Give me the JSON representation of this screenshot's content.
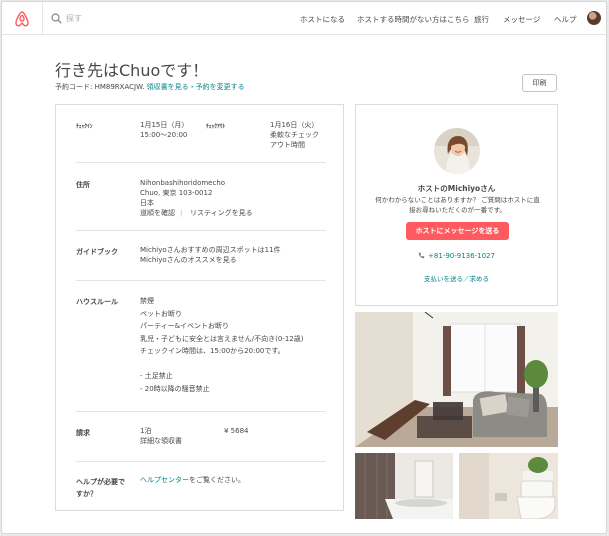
{
  "nav": {
    "search_placeholder": "探す",
    "links": [
      "ホストになる",
      "ホストする時間がない方はこちら",
      "旅行",
      "メッセージ",
      "ヘルプ"
    ]
  },
  "colors": {
    "brand": "#ff5a5f",
    "link": "#008489"
  },
  "page": {
    "title": "行き先はChuoです！",
    "code_label": "予約コード: HM89RXACJW.",
    "receipt_link": "領収書を見る",
    "separator": "・",
    "change_link": "予約を変更する",
    "print_button": "印刷"
  },
  "details": {
    "checkin_label": "ﾁｪｯｸｲﾝ",
    "checkin_date": "1月15日（月）",
    "checkin_time": "15:00〜20:00",
    "checkout_label": "ﾁｪｯｸｱｳﾄ",
    "checkout_date": "1月16日（火）",
    "checkout_time_1": "柔軟なチェック",
    "checkout_time_2": "アウト時間",
    "address_label": "住所",
    "address_lines": [
      "Nihonbashihoridomecho",
      "Chuo, 東京 103-0012",
      "日本"
    ],
    "directions_link": "道順を確認",
    "listing_link": "リスティングを見る",
    "guidebook_label": "ガイドブック",
    "guidebook_text": "Michiyoさんおすすめの周辺スポットは11件",
    "guidebook_link": "Michiyoさんのオススメを見る",
    "rules_label": "ハウスルール",
    "rules": [
      "禁煙",
      "ペットお断り",
      "パーティー&イベントお断り",
      "乳児・子どもに安全とは言えません/不向き(0-12歳)",
      "チェックイン時間は、15:00から20:00です。",
      "",
      "- 土足禁止",
      "- 20時以降の騒音禁止"
    ],
    "billing_label": "請求",
    "nights": "1泊",
    "receipt_detail_link": "詳細な領収書",
    "amount": "¥ 5684",
    "help_label_1": "ヘルプが必要で",
    "help_label_2": "すか？",
    "help_link": "ヘルプセンター",
    "help_suffix": "をご覧ください。"
  },
  "host": {
    "name": "ホストのMichiyoさん",
    "desc": "何かわからないことはありますか？ ご質問はホストに直接お尋ねいただくのが一番です。",
    "message_button": "ホストにメッセージを送る",
    "phone": "+81-90-9136-1027",
    "payment_link": "支払いを送る／求める"
  }
}
